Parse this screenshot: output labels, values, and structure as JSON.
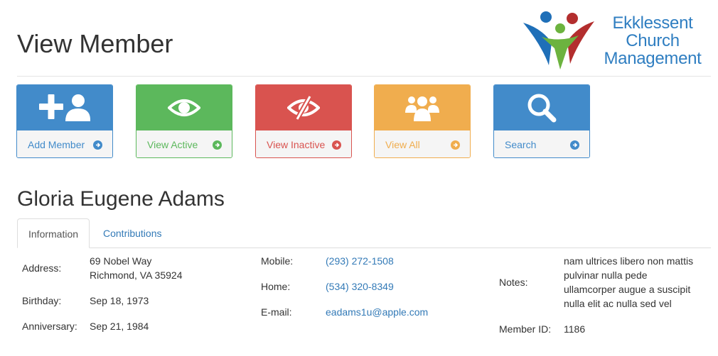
{
  "header": {
    "title": "View Member",
    "logo_lines": [
      "Ekklessent",
      "Church",
      "Management"
    ]
  },
  "actions": [
    {
      "label": "Add Member",
      "icon": "add-user-icon",
      "color": "#428bca"
    },
    {
      "label": "View Active",
      "icon": "eye-icon",
      "color": "#5cb85c"
    },
    {
      "label": "View Inactive",
      "icon": "eye-slash-icon",
      "color": "#d9534f"
    },
    {
      "label": "View All",
      "icon": "users-group-icon",
      "color": "#f0ad4e"
    },
    {
      "label": "Search",
      "icon": "search-icon",
      "color": "#428bca"
    }
  ],
  "member": {
    "name": "Gloria Eugene Adams",
    "tabs": [
      {
        "label": "Information",
        "active": true
      },
      {
        "label": "Contributions",
        "active": false
      }
    ],
    "info": {
      "address_label": "Address:",
      "address_line1": "69 Nobel Way",
      "address_line2": "Richmond, VA 35924",
      "birthday_label": "Birthday:",
      "birthday": "Sep 18, 1973",
      "anniversary_label": "Anniversary:",
      "anniversary": "Sep 21, 1984",
      "mobile_label": "Mobile:",
      "mobile": "(293) 272-1508",
      "home_label": "Home:",
      "home": "(534) 320-8349",
      "email_label": "E-mail:",
      "email": "eadams1u@apple.com",
      "notes_label": "Notes:",
      "notes_lines": [
        "nam ultrices libero non mattis",
        "pulvinar nulla pede",
        "ullamcorper augue a suscipit",
        "nulla elit ac nulla sed vel"
      ],
      "member_id_label": "Member ID:",
      "member_id": "1186"
    }
  }
}
